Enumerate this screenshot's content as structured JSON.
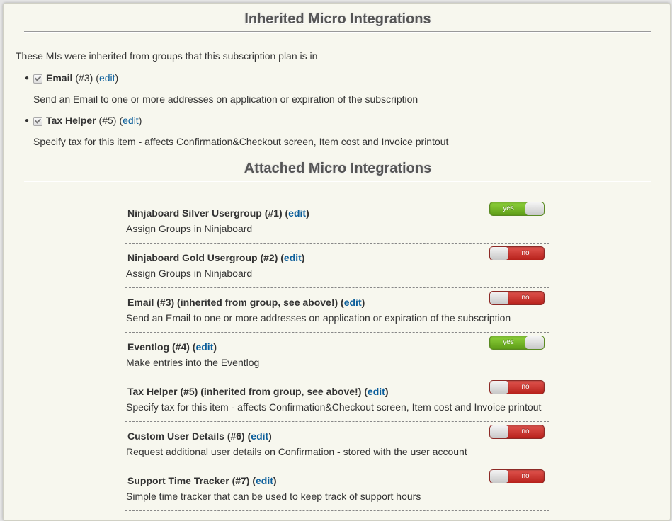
{
  "inherited": {
    "title": "Inherited Micro Integrations",
    "intro": "These MIs were inherited from groups that this subscription plan is in",
    "items": [
      {
        "name": "Email",
        "id": "(#3)",
        "edit_open": "(",
        "edit": "edit",
        "edit_close": ")",
        "description": "Send an Email to one or more addresses on application or expiration of the subscription"
      },
      {
        "name": "Tax Helper",
        "id": "(#5)",
        "edit_open": "(",
        "edit": "edit",
        "edit_close": ")",
        "description": "Specify tax for this item - affects Confirmation&Checkout screen, Item cost and Invoice printout"
      }
    ]
  },
  "attached": {
    "title": "Attached Micro Integrations",
    "items": [
      {
        "title": "Ninjaboard Silver Usergroup (#1) (",
        "edit": "edit",
        "close": ")",
        "description": "Assign Groups in Ninjaboard",
        "toggle": "yes"
      },
      {
        "title": "Ninjaboard Gold Usergroup (#2) (",
        "edit": "edit",
        "close": ")",
        "description": "Assign Groups in Ninjaboard",
        "toggle": "no"
      },
      {
        "title": "Email (#3) (inherited from group, see above!) (",
        "edit": "edit",
        "close": ")",
        "description": "Send an Email to one or more addresses on application or expiration of the subscription",
        "toggle": "no"
      },
      {
        "title": "Eventlog (#4) (",
        "edit": "edit",
        "close": ")",
        "description": "Make entries into the Eventlog",
        "toggle": "yes"
      },
      {
        "title": "Tax Helper (#5) (inherited from group, see above!) (",
        "edit": "edit",
        "close": ")",
        "description": "Specify tax for this item - affects Confirmation&Checkout screen, Item cost and Invoice printout",
        "toggle": "no"
      },
      {
        "title": "Custom User Details (#6) (",
        "edit": "edit",
        "close": ")",
        "description": "Request additional user details on Confirmation - stored with the user account",
        "toggle": "no"
      },
      {
        "title": "Support Time Tracker (#7) (",
        "edit": "edit",
        "close": ")",
        "description": "Simple time tracker that can be used to keep track of support hours",
        "toggle": "no"
      }
    ]
  },
  "colors": {
    "link": "#0b5e9b",
    "toggle_on": "#6fb424",
    "toggle_off": "#c9302c",
    "panel_bg": "#f7f7ee"
  }
}
